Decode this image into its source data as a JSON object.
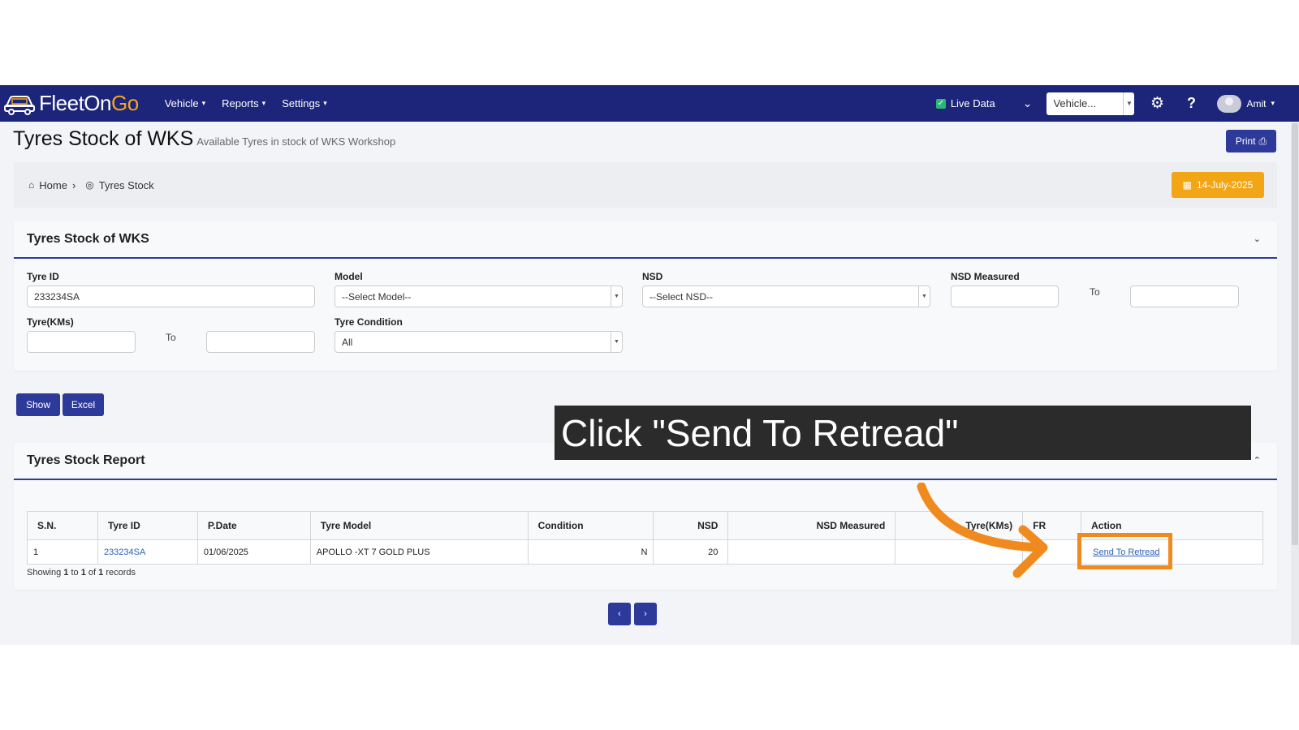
{
  "navbar": {
    "logo": {
      "fleet": "FleetOn",
      "go": "Go"
    },
    "menu": [
      {
        "label": "Vehicle"
      },
      {
        "label": "Reports"
      },
      {
        "label": "Settings"
      }
    ],
    "live_data_label": "Live Data",
    "vehicle_select": "Vehicle...",
    "user_name": "Amit"
  },
  "header": {
    "title": "Tyres Stock of WKS",
    "subtitle": "Available Tyres in stock of WKS Workshop",
    "print_label": "Print"
  },
  "breadcrumb": {
    "home": "Home",
    "current": "Tyres Stock",
    "date": "14-July-2025"
  },
  "filter_panel": {
    "title": "Tyres Stock of WKS",
    "tyre_id_label": "Tyre ID",
    "tyre_id_value": "233234SA",
    "model_label": "Model",
    "model_value": "--Select Model--",
    "nsd_label": "NSD",
    "nsd_value": "--Select NSD--",
    "nsd_measured_label": "NSD Measured",
    "to_label": "To",
    "tyre_kms_label": "Tyre(KMs)",
    "tyre_condition_label": "Tyre Condition",
    "tyre_condition_value": "All",
    "show_label": "Show",
    "excel_label": "Excel"
  },
  "report": {
    "title": "Tyres Stock Report",
    "columns": [
      "S.N.",
      "Tyre ID",
      "P.Date",
      "Tyre Model",
      "Condition",
      "NSD",
      "NSD Measured",
      "Tyre(KMs)",
      "FR",
      "Action"
    ],
    "rows": [
      {
        "sn": "1",
        "tyre_id": "233234SA",
        "pdate": "01/06/2025",
        "model": "APOLLO -XT 7 GOLD PLUS",
        "condition": "N",
        "nsd": "20",
        "nsd_measured": "",
        "kms": "",
        "fr": "",
        "action": "Send To Retread"
      }
    ],
    "showing": {
      "prefix": "Showing",
      "from": "1",
      "to_word": "to",
      "to": "1",
      "of_word": "of",
      "total": "1",
      "suffix": "records"
    },
    "pager_prev": "‹",
    "pager_next": "›"
  },
  "overlay": {
    "callout": "Click \"Send To Retread\"",
    "accent": "#f08a1e"
  },
  "colors": {
    "navy": "#1c2579",
    "primary": "#2d3a9a",
    "orange": "#f2a515"
  }
}
